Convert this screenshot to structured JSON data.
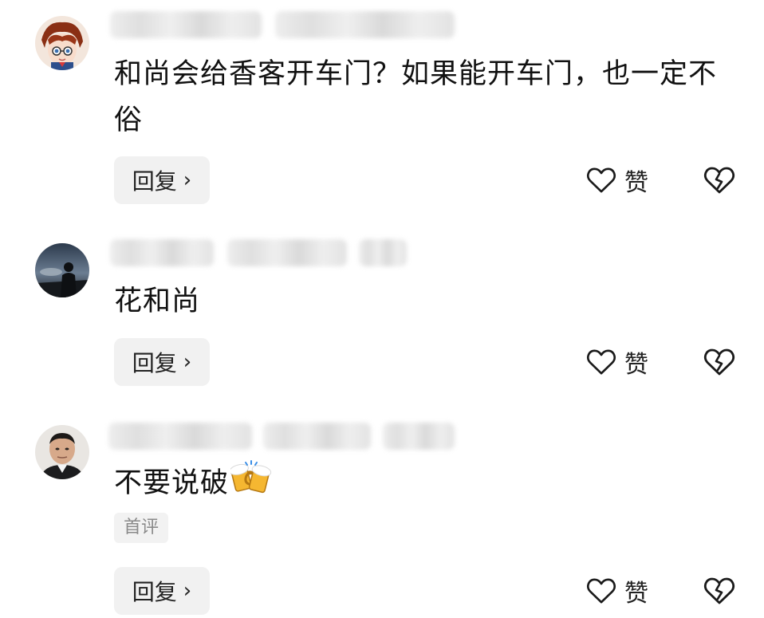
{
  "comments": [
    {
      "text": "和尚会给香客开车门？如果能开车门，也一定不俗",
      "reply_label": "回复",
      "like_label": "赞"
    },
    {
      "text": "花和尚",
      "reply_label": "回复",
      "like_label": "赞"
    },
    {
      "text": "不要说破",
      "emoji": "🍻",
      "badge": "首评",
      "reply_label": "回复",
      "like_label": "赞"
    }
  ],
  "icons": {
    "like": "heart-outline-icon",
    "dislike": "broken-heart-icon",
    "reply_chevron": "chevron-right-icon"
  },
  "colors": {
    "button_bg": "#f1f1f1",
    "badge_text": "#8a8a8a",
    "text": "#111111"
  }
}
